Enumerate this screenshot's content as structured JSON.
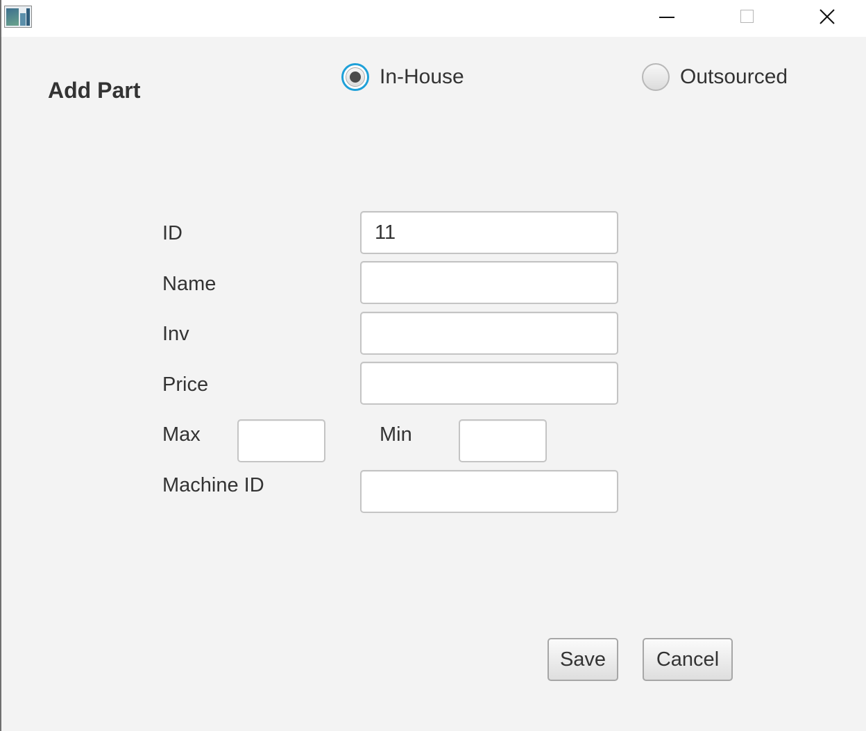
{
  "window": {
    "app_icon": "java-app-icon",
    "controls": {
      "minimize_icon": "minimize-icon",
      "maximize_icon": "maximize-icon",
      "close_icon": "close-icon"
    }
  },
  "form": {
    "title": "Add Part",
    "source_type": {
      "options": [
        {
          "label": "In-House",
          "selected": true
        },
        {
          "label": "Outsourced",
          "selected": false
        }
      ]
    },
    "fields": {
      "id": {
        "label": "ID",
        "value": "11"
      },
      "name": {
        "label": "Name",
        "value": ""
      },
      "inv": {
        "label": "Inv",
        "value": ""
      },
      "price": {
        "label": "Price",
        "value": ""
      },
      "max": {
        "label": "Max",
        "value": ""
      },
      "min": {
        "label": "Min",
        "value": ""
      },
      "machine_id": {
        "label": "Machine ID",
        "value": ""
      }
    },
    "buttons": {
      "save": "Save",
      "cancel": "Cancel"
    }
  },
  "colors": {
    "background": "#f3f3f3",
    "radio_focus": "#1ea0d8",
    "text": "#333333"
  }
}
